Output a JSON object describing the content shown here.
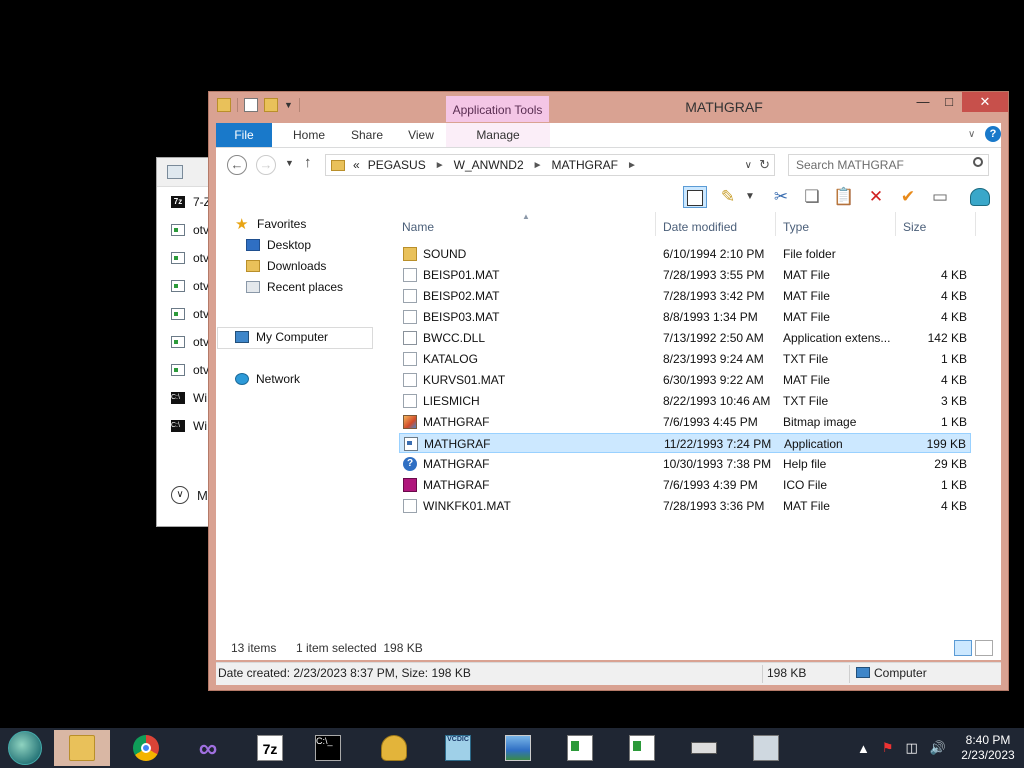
{
  "background_window": {
    "items": [
      {
        "icon": "7z",
        "label": "7-Z"
      },
      {
        "icon": "app",
        "label": "otv"
      },
      {
        "icon": "app",
        "label": "otv"
      },
      {
        "icon": "app",
        "label": "otv"
      },
      {
        "icon": "app",
        "label": "otv"
      },
      {
        "icon": "app",
        "label": "otv"
      },
      {
        "icon": "app",
        "label": "otv"
      },
      {
        "icon": "cmd",
        "label": "Wi"
      },
      {
        "icon": "cmd",
        "label": "Wi"
      }
    ],
    "more_label": "M"
  },
  "window": {
    "title": "MATHGRAF",
    "context_tab_group": "Application Tools",
    "ribbon_tabs": [
      "File",
      "Home",
      "Share",
      "View",
      "Manage"
    ]
  },
  "address": {
    "overflow": "«",
    "crumbs": [
      "PEGASUS",
      "W_ANWND2",
      "MATHGRAF"
    ]
  },
  "search": {
    "placeholder": "Search MATHGRAF"
  },
  "nav_pane": {
    "favorites": "Favorites",
    "desktop": "Desktop",
    "downloads": "Downloads",
    "recent": "Recent places",
    "computer": "My Computer",
    "network": "Network"
  },
  "columns": {
    "name": "Name",
    "date": "Date modified",
    "type": "Type",
    "size": "Size"
  },
  "files": [
    {
      "icon": "folder",
      "name": "SOUND",
      "date": "6/10/1994 2:10 PM",
      "type": "File folder",
      "size": ""
    },
    {
      "icon": "file",
      "name": "BEISP01.MAT",
      "date": "7/28/1993 3:55 PM",
      "type": "MAT File",
      "size": "4 KB"
    },
    {
      "icon": "file",
      "name": "BEISP02.MAT",
      "date": "7/28/1993 3:42 PM",
      "type": "MAT File",
      "size": "4 KB"
    },
    {
      "icon": "file",
      "name": "BEISP03.MAT",
      "date": "8/8/1993 1:34 PM",
      "type": "MAT File",
      "size": "4 KB"
    },
    {
      "icon": "dll",
      "name": "BWCC.DLL",
      "date": "7/13/1992 2:50 AM",
      "type": "Application extens...",
      "size": "142 KB"
    },
    {
      "icon": "file",
      "name": "KATALOG",
      "date": "8/23/1993 9:24 AM",
      "type": "TXT File",
      "size": "1 KB"
    },
    {
      "icon": "file",
      "name": "KURVS01.MAT",
      "date": "6/30/1993 9:22 AM",
      "type": "MAT File",
      "size": "4 KB"
    },
    {
      "icon": "file",
      "name": "LIESMICH",
      "date": "8/22/1993 10:46 AM",
      "type": "TXT File",
      "size": "3 KB"
    },
    {
      "icon": "bmp",
      "name": "MATHGRAF",
      "date": "7/6/1993 4:45 PM",
      "type": "Bitmap image",
      "size": "1 KB"
    },
    {
      "icon": "app",
      "name": "MATHGRAF",
      "date": "11/22/1993 7:24 PM",
      "type": "Application",
      "size": "199 KB",
      "selected": true
    },
    {
      "icon": "help",
      "name": "MATHGRAF",
      "date": "10/30/1993 7:38 PM",
      "type": "Help file",
      "size": "29 KB"
    },
    {
      "icon": "ico",
      "name": "MATHGRAF",
      "date": "7/6/1993 4:39 PM",
      "type": "ICO File",
      "size": "1 KB"
    },
    {
      "icon": "file",
      "name": "WINKFK01.MAT",
      "date": "7/28/1993 3:36 PM",
      "type": "MAT File",
      "size": "4 KB"
    }
  ],
  "status": {
    "count": "13 items",
    "selection": "1 item selected  198 KB"
  },
  "details": {
    "info": "Date created: 2/23/2023 8:37 PM, Size: 198 KB",
    "size": "198 KB",
    "location": "Computer"
  },
  "taskbar": {
    "apps": [
      "file-explorer",
      "chrome",
      "visual-studio",
      "7-zip",
      "command-prompt",
      "shell",
      "vcdic",
      "photos",
      "document",
      "document",
      "drive",
      "monitor"
    ],
    "vcdic_label": "VCDIC",
    "time": "8:40 PM",
    "date": "2/23/2023"
  },
  "colors": {
    "accent": "#1979ca",
    "titlebar": "#d9a292",
    "close": "#c7504b",
    "selection": "#cce8ff"
  }
}
